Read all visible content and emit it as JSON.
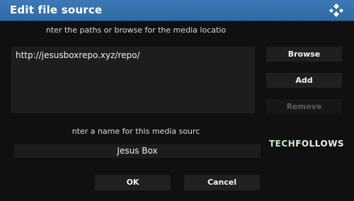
{
  "dialog": {
    "title": "Edit file source",
    "logo_icon": "kodi-logo-icon"
  },
  "paths": {
    "prompt": "nter the paths or browse for the media locatio",
    "entries": [
      "http://jesusboxrepo.xyz/repo/"
    ]
  },
  "buttons": {
    "browse": "Browse",
    "add": "Add",
    "remove": "Remove",
    "ok": "OK",
    "cancel": "Cancel"
  },
  "name": {
    "prompt": "nter a name for this media sourc",
    "value": "Jesus Box"
  },
  "watermark": {
    "prefix": "TECH",
    "suffix": "FOLLOWS"
  },
  "colors": {
    "titlebar": "#3572ad",
    "background": "#101010",
    "field": "#1d1d1d",
    "disabled_text": "#5c5c5c"
  }
}
